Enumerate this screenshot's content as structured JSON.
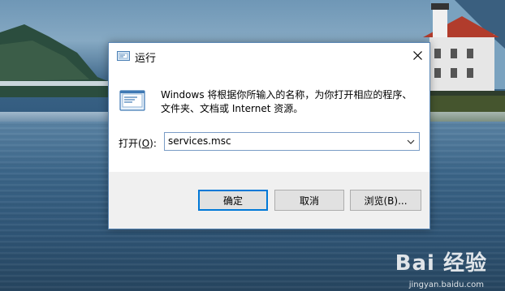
{
  "dialog": {
    "title": "运行",
    "description": "Windows 将根据你所输入的名称，为你打开相应的程序、文件夹、文档或 Internet 资源。",
    "open_label": "打开(",
    "open_label_key": "O",
    "open_label_end": "):",
    "open_value": "services.msc",
    "buttons": {
      "ok": "确定",
      "cancel": "取消",
      "browse": "浏览(B)..."
    }
  },
  "watermark": {
    "brand": "Bai 经验",
    "url": "jingyan.baidu.com"
  },
  "colors": {
    "accent": "#0078d7",
    "dialog_border": "#5a86b4",
    "footer_bg": "#f0f0f0",
    "button_bg": "#e1e1e1"
  },
  "icons": [
    "run-icon",
    "close-icon",
    "chevron-down-icon"
  ]
}
